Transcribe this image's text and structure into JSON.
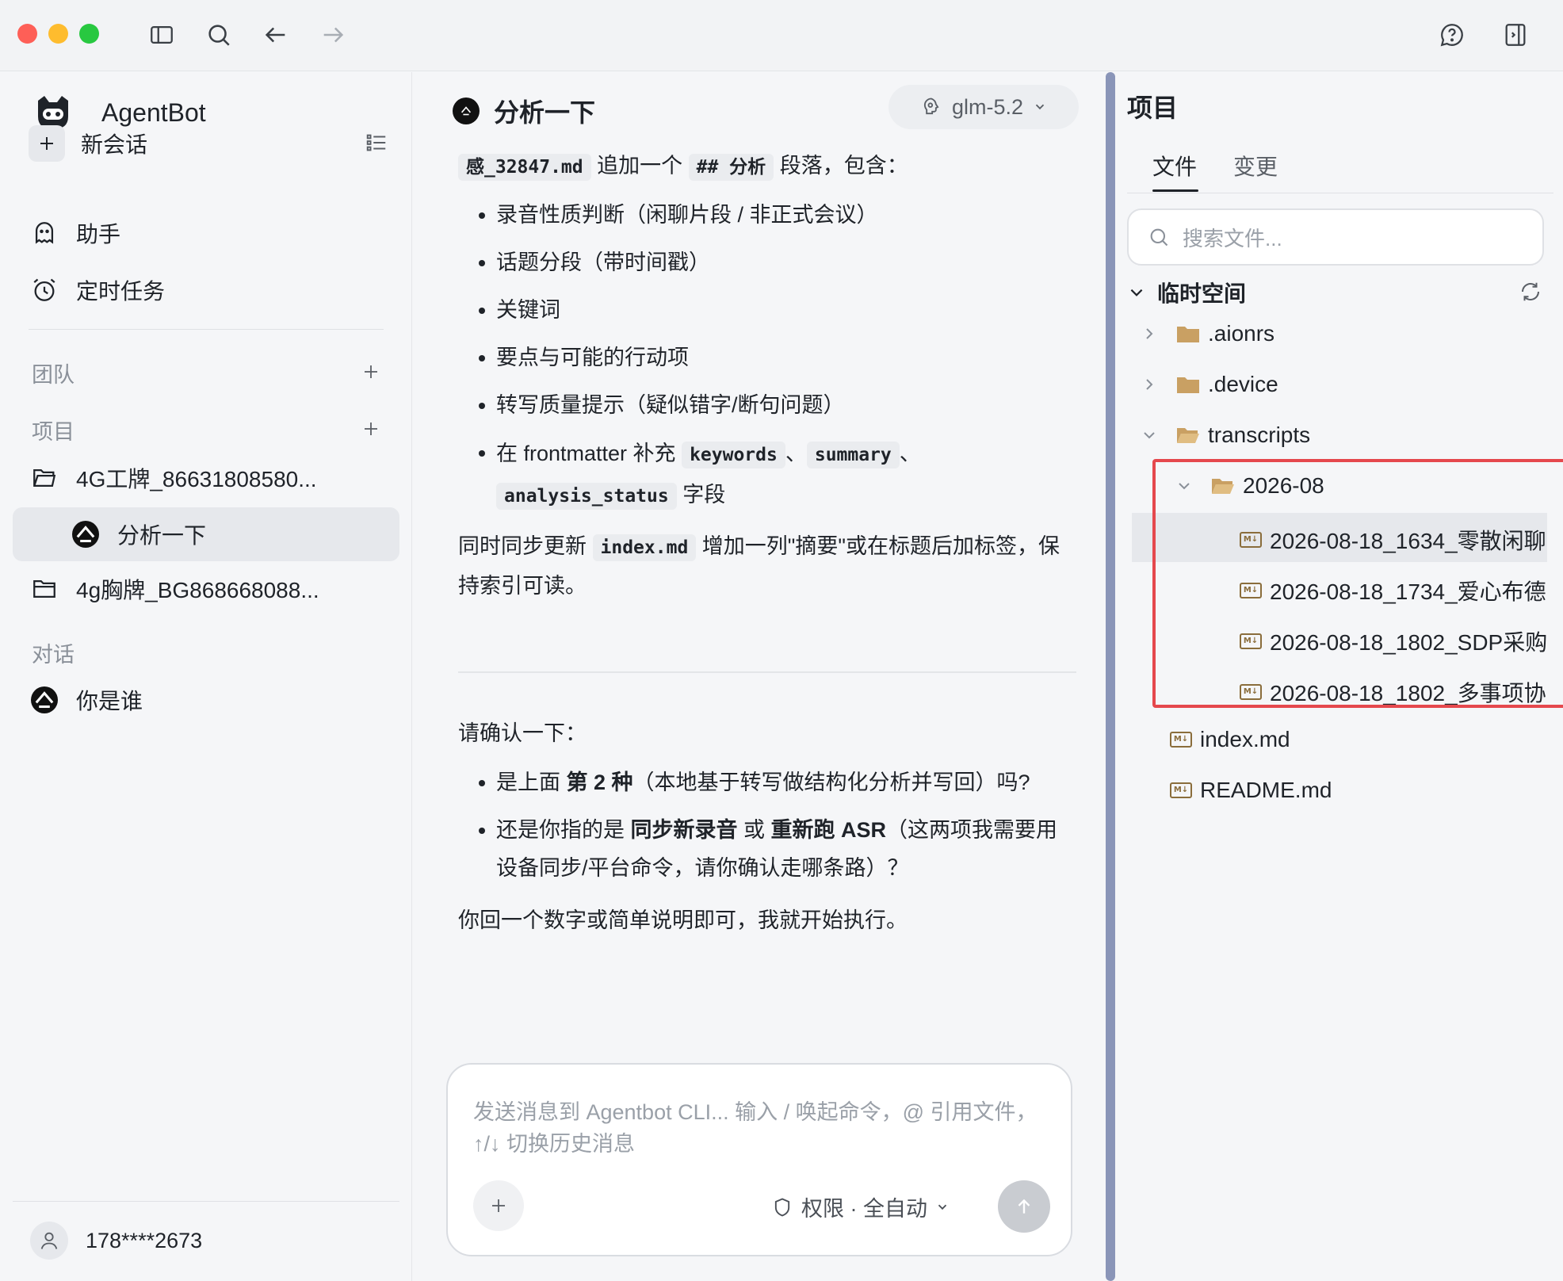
{
  "sidebar": {
    "brand": "AgentBot",
    "new_chat": "新会话",
    "assistant": "助手",
    "scheduled": "定时任务",
    "team_label": "团队",
    "project_label": "项目",
    "projects": [
      {
        "name": "4G工牌_86631808580...",
        "sessions": [
          {
            "title": "分析一下",
            "active": true
          }
        ]
      },
      {
        "name": "4g胸牌_BG868668088..."
      }
    ],
    "dialog_label": "对话",
    "dialogs": [
      {
        "title": "你是谁"
      }
    ],
    "user": "178****2673"
  },
  "chat": {
    "title": "分析一下",
    "model": "glm-5.2",
    "p1_code": "感_32847.md",
    "p1_mid": " 追加一个 ",
    "p1_code2": "## 分析",
    "p1_tail": " 段落，包含：",
    "bullets": [
      "录音性质判断（闲聊片段 / 非正式会议）",
      "话题分段（带时间戳）",
      "关键词",
      "要点与可能的行动项",
      "转写质量提示（疑似错字/断句问题）"
    ],
    "fm_prefix": "在 frontmatter 补充 ",
    "fm_code1": "keywords",
    "fm_sep1": "、",
    "fm_code2": "summary",
    "fm_sep2": "、",
    "fm_code3": "analysis_status",
    "fm_suffix": " 字段",
    "sync_prefix": "同时同步更新 ",
    "sync_code": "index.md",
    "sync_suffix": " 增加一列\"摘要\"或在标题后加标签，保持索引可读。",
    "confirm": "请确认一下：",
    "q1_a": "是上面 ",
    "q1_b": "第 2 种",
    "q1_c": "（本地基于转写做结构化分析并写回）吗?",
    "q2_a": "还是你指的是 ",
    "q2_b": "同步新录音",
    "q2_c": " 或 ",
    "q2_d": "重新跑 ASR",
    "q2_e": "（这两项我需要用设备同步/平台命令，请你确认走哪条路）？",
    "closing": "你回一个数字或简单说明即可，我就开始执行。",
    "composer_placeholder": "发送消息到 Agentbot CLI... 输入 / 唤起命令，@ 引用文件，↑/↓ 切换历史消息",
    "permission": "权限 · 全自动"
  },
  "panel": {
    "title": "项目",
    "tabs": [
      "文件",
      "变更"
    ],
    "search_placeholder": "搜索文件...",
    "root": "临时空间",
    "tree": [
      {
        "name": ".aionrs"
      },
      {
        "name": ".device"
      },
      {
        "name": "transcripts"
      },
      {
        "name": "2026-08"
      },
      {
        "name": "2026-08-18_1634_零散闲聊"
      },
      {
        "name": "2026-08-18_1734_爱心布德"
      },
      {
        "name": "2026-08-18_1802_SDP采购"
      },
      {
        "name": "2026-08-18_1802_多事项协"
      },
      {
        "name": "index.md"
      },
      {
        "name": "README.md"
      }
    ]
  },
  "colors": {
    "highlight_border": "#e5484d",
    "splitter": "#8a95b8",
    "folder": "#c9a063"
  }
}
